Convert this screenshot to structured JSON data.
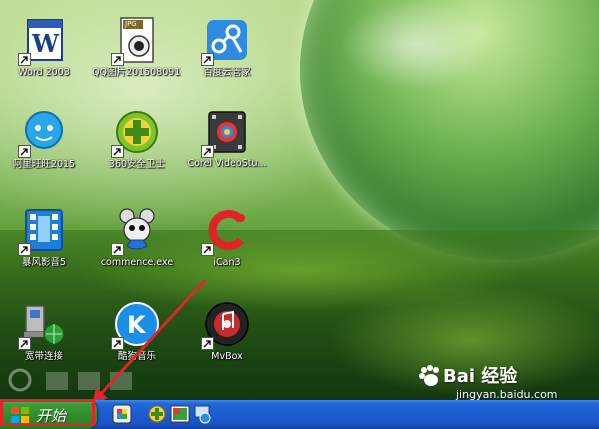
{
  "desktop": {
    "icons": [
      {
        "label": "Word 2003"
      },
      {
        "label": "QQ图片20150809155..."
      },
      {
        "label": "百度云管家"
      },
      {
        "label": "阿里旺旺2015"
      },
      {
        "label": "360安全卫士"
      },
      {
        "label": "Corel VideoStu..."
      },
      {
        "label": "暴风影音5"
      },
      {
        "label": "commence.exe"
      },
      {
        "label": "iCan3"
      },
      {
        "label": "宽带连接"
      },
      {
        "label": "酷狗音乐"
      },
      {
        "label": "MvBox"
      }
    ],
    "jpg_badge": "JPG"
  },
  "taskbar": {
    "start_label": "开始"
  },
  "watermark": {
    "brand": "Bai 经验",
    "url": "jingyan.baidu.com"
  },
  "colors": {
    "taskbar_blue": "#1d5cd0",
    "start_green": "#2f8a2c",
    "highlight_red": "#e2252b"
  }
}
